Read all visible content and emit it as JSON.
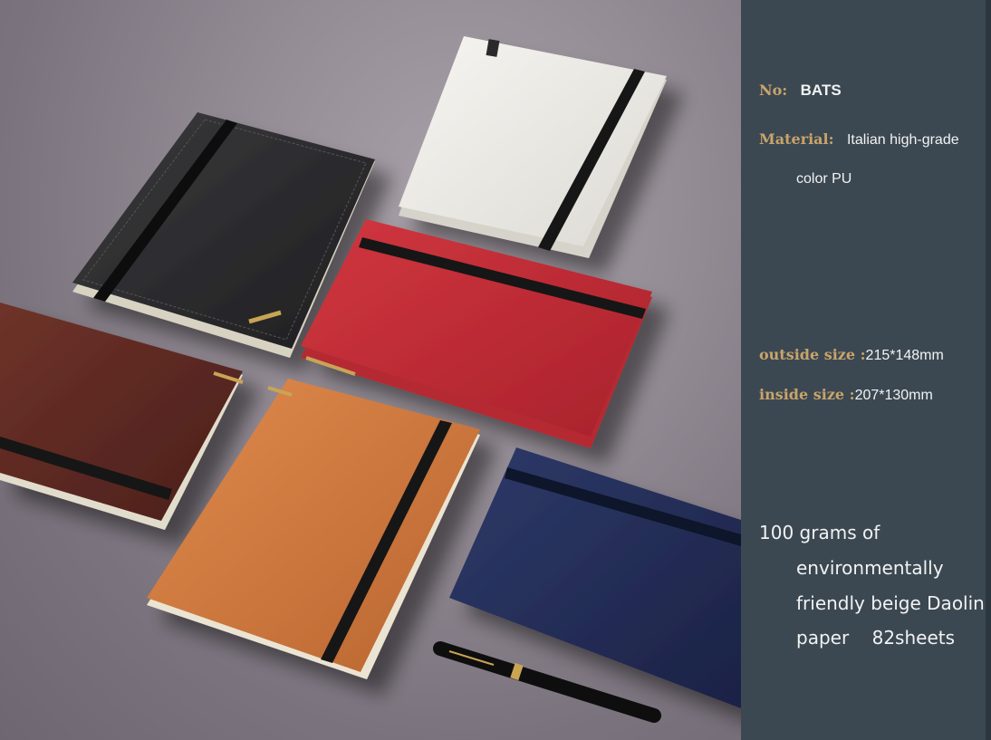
{
  "specs": {
    "no_label": "No:",
    "no_value": "BATS",
    "material_label": "Material:",
    "material_value_line1": "Italian high-grade",
    "material_value_line2": "color PU",
    "outside_label": "outside size :",
    "outside_value": "215*148mm",
    "inside_label": "inside size :",
    "inside_value": "207*130mm"
  },
  "paper_description": {
    "line1": "100 grams of",
    "line2": "environmentally",
    "line3": "friendly beige Daolin",
    "line4": "paper    82sheets"
  },
  "colors": {
    "panel_bg": "#3b4852",
    "label_gold": "#c9a46a",
    "text_white": "#f2f2f2",
    "notebook_black": "#2a2a2c",
    "notebook_white": "#ecebe6",
    "notebook_red": "#c0303a",
    "notebook_brown": "#5e2a24",
    "notebook_orange": "#cf7a3f",
    "notebook_navy": "#26305a"
  }
}
